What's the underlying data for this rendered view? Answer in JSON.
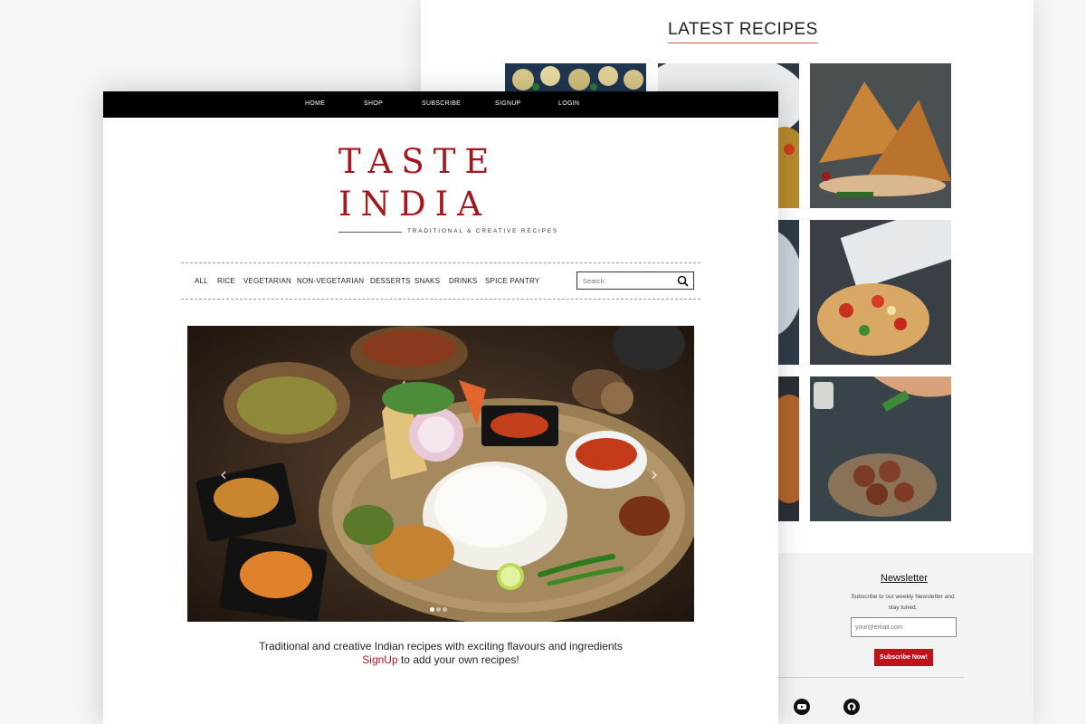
{
  "latest": {
    "title": "LATEST RECIPES"
  },
  "newsletter": {
    "title": "Newsletter",
    "text": "Subscribe to our weekly Newsletter and stay tuned.",
    "placeholder": "your@email.com",
    "button": "Subscribe Now!"
  },
  "social": [
    "youtube-icon",
    "github-icon"
  ],
  "top_nav": [
    "HOME",
    "SHOP",
    "SUBSCRIBE",
    "SIGNUP",
    "LOGIN"
  ],
  "logo": {
    "line1": "TASTE",
    "line2": "INDIA",
    "tagline": "TRADITIONAL & CREATIVE RECIPES"
  },
  "categories": [
    "ALL",
    "RICE",
    "VEGETARIAN",
    "NON-VEGETARIAN",
    "DESSERTS",
    "SNAKS",
    "DRINKS",
    "SPICE PANTRY"
  ],
  "search": {
    "placeholder": "Search"
  },
  "hero": {
    "slides": 3,
    "active_slide": 1
  },
  "intro": {
    "tagline": "Traditional and creative Indian recipes with exciting flavours and ingredients",
    "signup_link": "SignUp",
    "signup_rest": " to add your own recipes!"
  },
  "colors": {
    "accent": "#a3181f",
    "button": "#c0121b",
    "nav": "#000000"
  }
}
